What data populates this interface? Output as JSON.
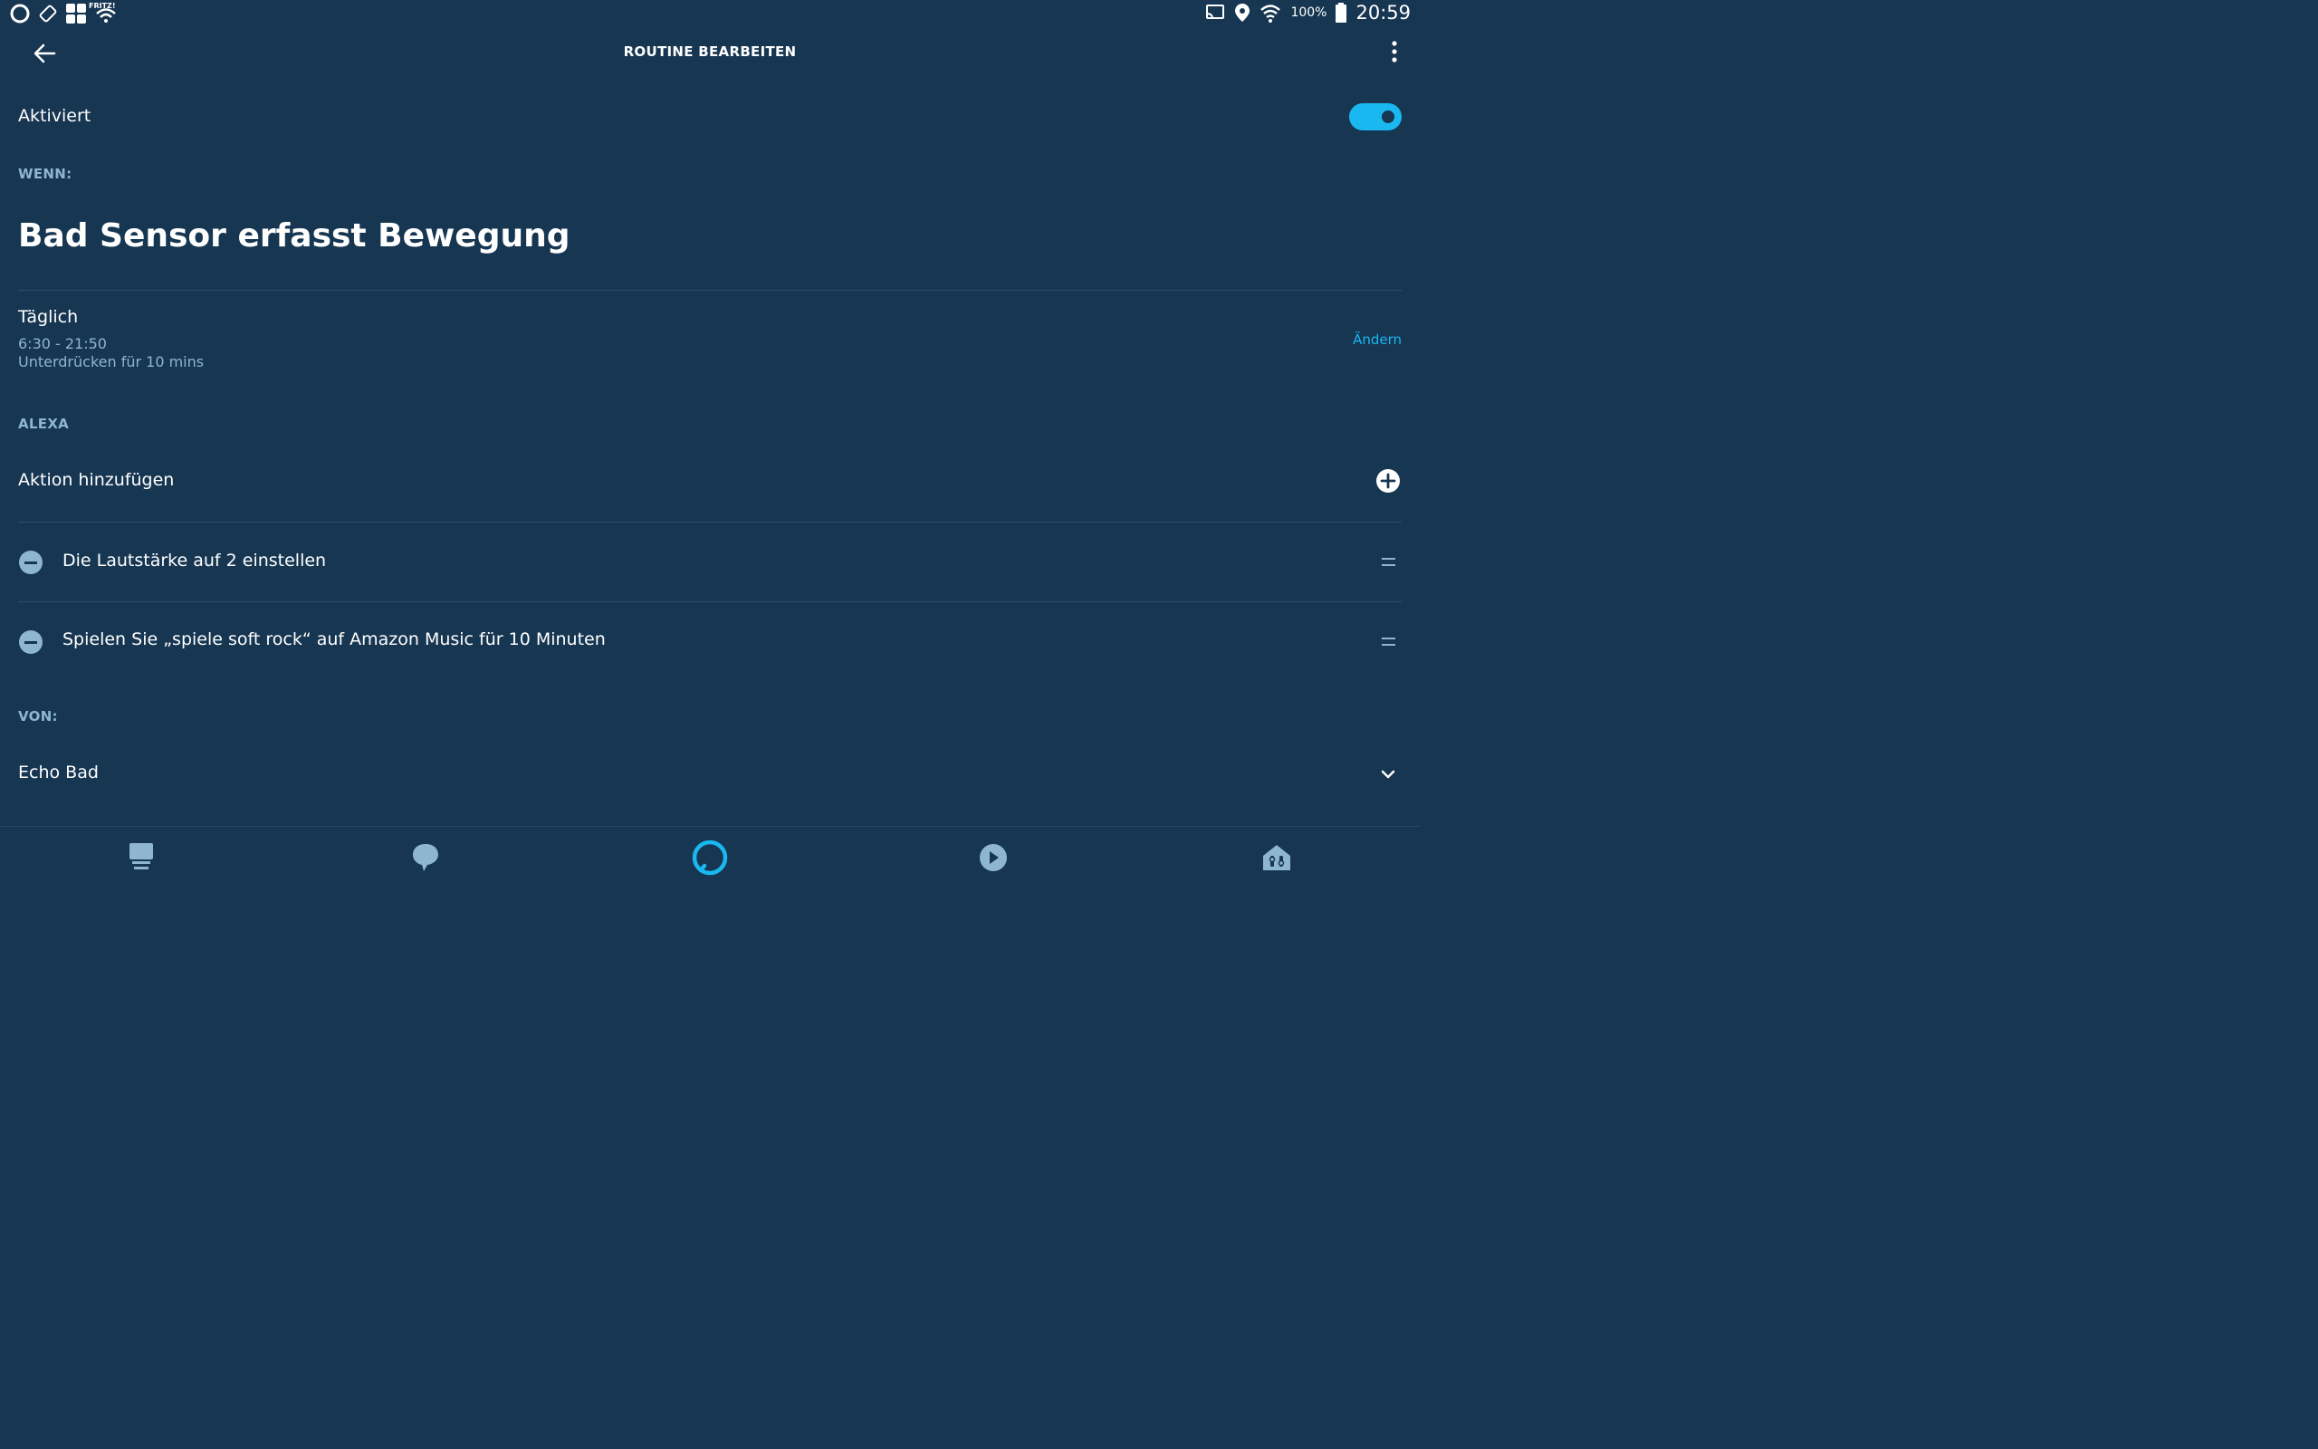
{
  "status_bar": {
    "carrier_label": "FRITZ!",
    "battery": "100%",
    "time": "20:59"
  },
  "header": {
    "title": "ROUTINE BEARBEITEN"
  },
  "enabled": {
    "label": "Aktiviert",
    "value": true
  },
  "when": {
    "section_label": "WENN:",
    "trigger": "Bad Sensor erfasst Bewegung",
    "schedule_title": "Täglich",
    "time_range": "6:30 - 21:50",
    "suppress": "Unterdrücken für 10 mins",
    "change_label": "Ändern"
  },
  "alexa": {
    "section_label": "ALEXA",
    "add_action_label": "Aktion hinzufügen",
    "actions": [
      {
        "label": "Die Lautstärke auf 2 einstellen"
      },
      {
        "label": "Spielen Sie „spiele soft rock“ auf Amazon Music für  10 Minuten"
      }
    ]
  },
  "from": {
    "section_label": "VON:",
    "device": "Echo Bad"
  },
  "colors": {
    "background": "#163652",
    "accent": "#1ab8f0",
    "muted": "#8fb6cf"
  },
  "icons": {
    "nav": [
      "home-icon",
      "communicate-icon",
      "alexa-icon",
      "play-icon",
      "devices-icon"
    ]
  }
}
